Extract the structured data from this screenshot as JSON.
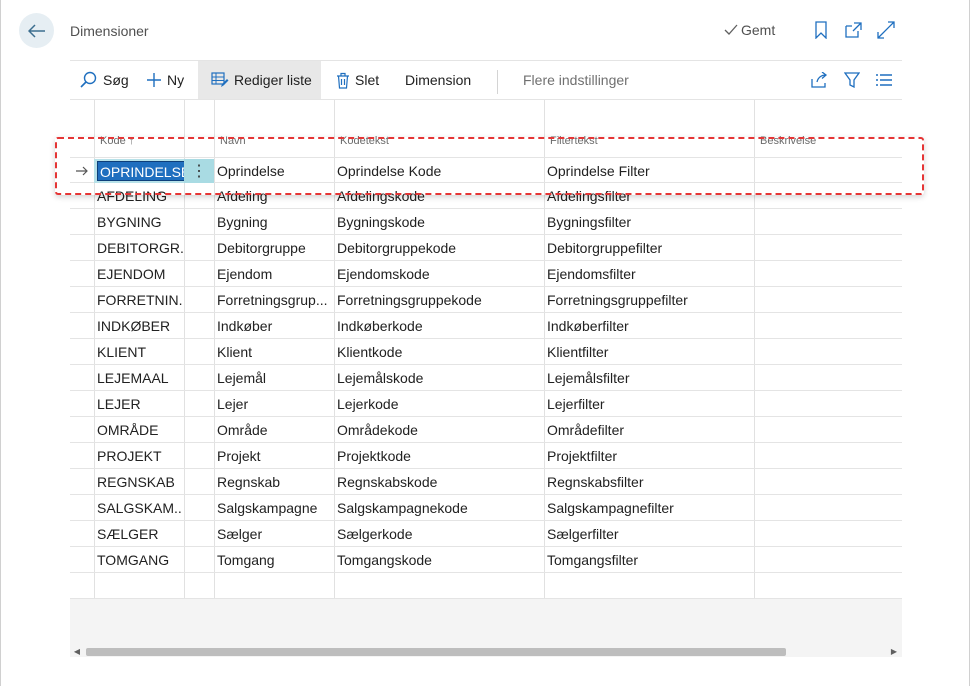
{
  "header": {
    "title": "Dimensioner",
    "saved_label": "Gemt"
  },
  "toolbar": {
    "search_label": "Søg",
    "new_label": "Ny",
    "edit_list_label": "Rediger liste",
    "delete_label": "Slet",
    "dimension_label": "Dimension",
    "more_options_label": "Flere indstillinger"
  },
  "table": {
    "columns": [
      "Kode ↑",
      "Navn",
      "Kodetekst",
      "Filtertekst",
      "Beskrivelse"
    ],
    "rows": [
      {
        "kode": "OPRINDELSE",
        "navn": "Oprindelse",
        "kodetekst": "Oprindelse Kode",
        "filtertekst": "Oprindelse Filter",
        "beskrivelse": ""
      },
      {
        "kode": "AFDELING",
        "navn": "Afdeling",
        "kodetekst": "Afdelingskode",
        "filtertekst": "Afdelingsfilter",
        "beskrivelse": ""
      },
      {
        "kode": "BYGNING",
        "navn": "Bygning",
        "kodetekst": "Bygningskode",
        "filtertekst": "Bygningsfilter",
        "beskrivelse": ""
      },
      {
        "kode": "DEBITORGR...",
        "navn": "Debitorgruppe",
        "kodetekst": "Debitorgruppekode",
        "filtertekst": "Debitorgruppefilter",
        "beskrivelse": ""
      },
      {
        "kode": "EJENDOM",
        "navn": "Ejendom",
        "kodetekst": "Ejendomskode",
        "filtertekst": "Ejendomsfilter",
        "beskrivelse": ""
      },
      {
        "kode": "FORRETNIN...",
        "navn": "Forretningsgrup...",
        "kodetekst": "Forretningsgruppekode",
        "filtertekst": "Forretningsgruppefilter",
        "beskrivelse": ""
      },
      {
        "kode": "INDKØBER",
        "navn": "Indkøber",
        "kodetekst": "Indkøberkode",
        "filtertekst": "Indkøberfilter",
        "beskrivelse": ""
      },
      {
        "kode": "KLIENT",
        "navn": "Klient",
        "kodetekst": "Klientkode",
        "filtertekst": "Klientfilter",
        "beskrivelse": ""
      },
      {
        "kode": "LEJEMAAL",
        "navn": "Lejemål",
        "kodetekst": "Lejemålskode",
        "filtertekst": "Lejemålsfilter",
        "beskrivelse": ""
      },
      {
        "kode": "LEJER",
        "navn": "Lejer",
        "kodetekst": "Lejerkode",
        "filtertekst": "Lejerfilter",
        "beskrivelse": ""
      },
      {
        "kode": "OMRÅDE",
        "navn": "Område",
        "kodetekst": "Områdekode",
        "filtertekst": "Områdefilter",
        "beskrivelse": ""
      },
      {
        "kode": "PROJEKT",
        "navn": "Projekt",
        "kodetekst": "Projektkode",
        "filtertekst": "Projektfilter",
        "beskrivelse": ""
      },
      {
        "kode": "REGNSKAB",
        "navn": "Regnskab",
        "kodetekst": "Regnskabskode",
        "filtertekst": "Regnskabsfilter",
        "beskrivelse": ""
      },
      {
        "kode": "SALGSKAM...",
        "navn": "Salgskampagne",
        "kodetekst": "Salgskampagnekode",
        "filtertekst": "Salgskampagnefilter",
        "beskrivelse": ""
      },
      {
        "kode": "SÆLGER",
        "navn": "Sælger",
        "kodetekst": "Sælgerkode",
        "filtertekst": "Sælgerfilter",
        "beskrivelse": ""
      },
      {
        "kode": "TOMGANG",
        "navn": "Tomgang",
        "kodetekst": "Tomgangskode",
        "filtertekst": "Tomgangsfilter",
        "beskrivelse": ""
      }
    ],
    "selected_row_index": 0,
    "row_context_menu_glyph": "⋮"
  },
  "colors": {
    "accent": "#1f6fbf",
    "selected_cell_bg": "#b7e1e8",
    "highlight_border": "#e53535"
  }
}
